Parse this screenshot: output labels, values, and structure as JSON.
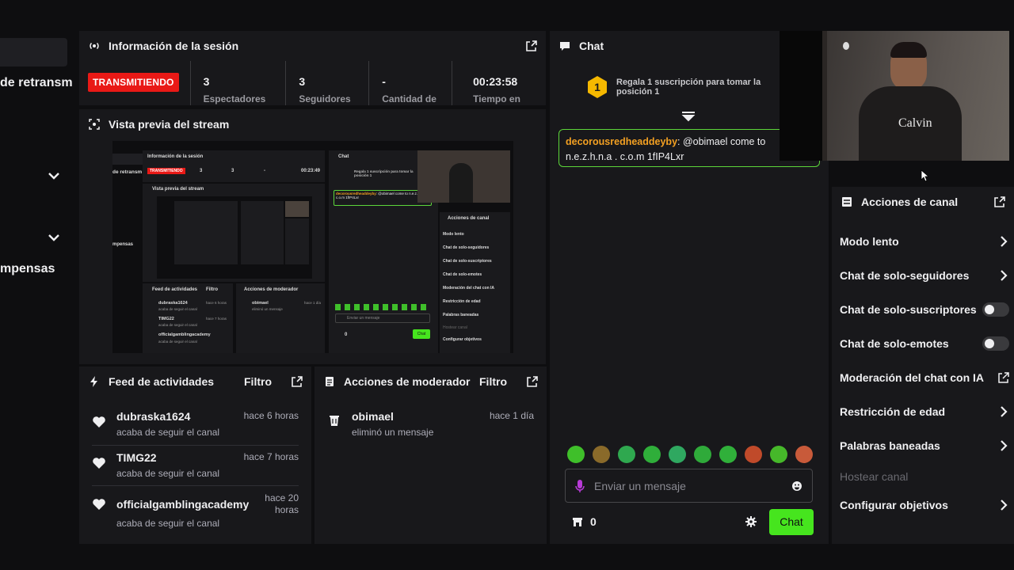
{
  "left_strip": {
    "retransmision_label": "de retransm",
    "recompensas_label": "mpensas"
  },
  "session": {
    "title": "Información de la sesión",
    "status_badge": "TRANSMITIENDO",
    "stats": [
      {
        "value": "3",
        "label": "Espectadores"
      },
      {
        "value": "3",
        "label": "Seguidores"
      },
      {
        "value": "-",
        "label": "Cantidad de"
      },
      {
        "value": "00:23:58",
        "label": "Tiempo en"
      }
    ]
  },
  "preview": {
    "title": "Vista previa del stream"
  },
  "feed": {
    "title": "Feed de actividades",
    "filter_label": "Filtro",
    "items": [
      {
        "user": "dubraska1624",
        "action": "acaba de seguir el canal",
        "time": "hace 6 horas"
      },
      {
        "user": "TIMG22",
        "action": "acaba de seguir el canal",
        "time": "hace 7 horas"
      },
      {
        "user": "officialgamblingacademy",
        "action": "acaba de seguir el canal",
        "time_line1": "hace 20",
        "time_line2": "horas"
      }
    ]
  },
  "moderator": {
    "title": "Acciones de moderador",
    "filter_label": "Filtro",
    "items": [
      {
        "user": "obimael",
        "action": "eliminó un mensaje",
        "time": "hace 1 día"
      }
    ]
  },
  "chat": {
    "title": "Chat",
    "sub_rank": "1",
    "sub_banner": "Regala 1 suscripción para tomar la posición 1",
    "pinned_user": "decorousredheaddeyby",
    "pinned_text": ": @obimael come to n.e.z.h.n.a . c.o.m 1fIP4Lxr",
    "input_placeholder": "Enviar un mensaje",
    "points": "0",
    "send_label": "Chat",
    "emotes": [
      "#3fbf2a",
      "#8a6a2a",
      "#2fa84f",
      "#2fae3a",
      "#2fa860",
      "#2faa3a",
      "#30b03a",
      "#c04a2a",
      "#46b82a",
      "#c85a3a"
    ]
  },
  "webcam": {
    "shirt_text": "Calvin"
  },
  "actions": {
    "title": "Acciones de canal",
    "items": [
      {
        "label": "Modo lento",
        "control": "chevron"
      },
      {
        "label": "Chat de solo-seguidores",
        "control": "chevron"
      },
      {
        "label": "Chat de solo-suscriptores",
        "control": "toggle"
      },
      {
        "label": "Chat de solo-emotes",
        "control": "toggle"
      },
      {
        "label": "Moderación del chat con IA",
        "control": "external"
      },
      {
        "label": "Restricción de edad",
        "control": "chevron"
      },
      {
        "label": "Palabras baneadas",
        "control": "chevron"
      },
      {
        "label": "Hostear canal",
        "control": "disabled"
      },
      {
        "label": "Configurar objetivos",
        "control": "chevron"
      }
    ]
  },
  "mini_preview": {
    "session_title": "Información de la sesión",
    "badge": "TRANSMITIENDO",
    "v1": "3",
    "v2": "3",
    "v3": "-",
    "time": "00:23:49",
    "preview_title": "Vista previa del stream",
    "chat_title": "Chat",
    "sub_text": "Regala 1 suscripción para tomar la posición 1",
    "pinned_user": "decorousredheaddeyby",
    "pinned_text": ": @obimael come to n.e.z.h.n.a . c.o.m 1fIP4Lxr",
    "input_placeholder": "Enviar un mensaje",
    "points": "0",
    "send": "Chat",
    "retrans": "de retransm",
    "recompensas": "mpensas",
    "actions_title": "Acciones de canal",
    "actions": [
      "Modo lento",
      "Chat de solo-seguidores",
      "Chat de solo-suscriptores",
      "Chat de solo-emotes",
      "Moderación del chat con IA",
      "Restricción de edad",
      "Palabras baneadas",
      "Hostear canal",
      "Configurar objetivos"
    ],
    "feed_title": "Feed de actividades",
    "filter": "Filtro",
    "feed": [
      {
        "user": "dubraska1624",
        "action": "acaba de seguir el canal",
        "time": "hace 6 horas"
      },
      {
        "user": "TIMG22",
        "action": "acaba de seguir el canal",
        "time": "hace 7 horas"
      },
      {
        "user": "officialgamblingacademy",
        "action": "acaba de seguir el canal",
        "time": "hace 20 horas"
      }
    ],
    "mod_title": "Acciones de moderador",
    "mod_user": "obimael",
    "mod_action": "eliminó un mensaje",
    "mod_time": "hace 1 día"
  }
}
